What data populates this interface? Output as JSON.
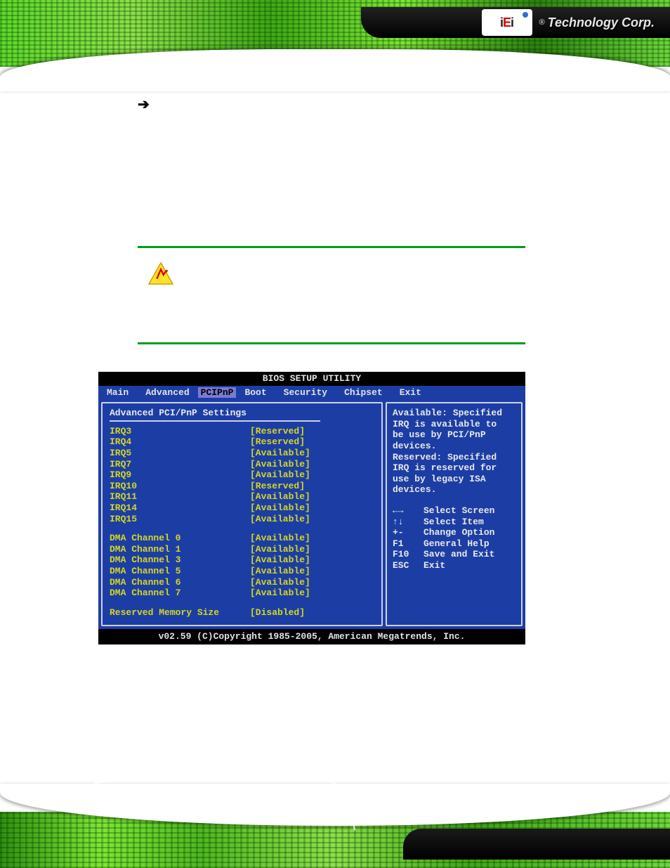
{
  "brand": {
    "logo_letters_i": "i",
    "logo_letters_e": "E",
    "logo_letters_i2": "i",
    "reg": "®",
    "name": "Technology Corp."
  },
  "arrow_glyph": "➔",
  "bios": {
    "title": "BIOS SETUP UTILITY",
    "tabs": [
      "Main",
      "Advanced",
      "PCIPnP",
      "Boot",
      "Security",
      "Chipset",
      "Exit"
    ],
    "active_tab_index": 2,
    "section_heading": "Advanced PCI/PnP Settings",
    "irq": [
      {
        "label": "IRQ3",
        "value": "[Reserved]"
      },
      {
        "label": "IRQ4",
        "value": "[Reserved]"
      },
      {
        "label": "IRQ5",
        "value": "[Available]"
      },
      {
        "label": "IRQ7",
        "value": "[Available]"
      },
      {
        "label": "IRQ9",
        "value": "[Available]"
      },
      {
        "label": "IRQ10",
        "value": "[Reserved]"
      },
      {
        "label": "IRQ11",
        "value": "[Available]"
      },
      {
        "label": "IRQ14",
        "value": "[Available]"
      },
      {
        "label": "IRQ15",
        "value": "[Available]"
      }
    ],
    "dma": [
      {
        "label": "DMA Channel 0",
        "value": "[Available]"
      },
      {
        "label": "DMA Channel 1",
        "value": "[Available]"
      },
      {
        "label": "DMA Channel 3",
        "value": "[Available]"
      },
      {
        "label": "DMA Channel 5",
        "value": "[Available]"
      },
      {
        "label": "DMA Channel 6",
        "value": "[Available]"
      },
      {
        "label": "DMA Channel 7",
        "value": "[Available]"
      }
    ],
    "reserved_mem": {
      "label": "Reserved Memory Size",
      "value": "[Disabled]"
    },
    "help": {
      "line1": "Available: Specified",
      "line2": "IRQ is available to",
      "line3": "be use by PCI/PnP",
      "line4": "devices.",
      "line5": "Reserved: Specified",
      "line6": "IRQ is reserved for",
      "line7": "use by legacy ISA",
      "line8": "devices."
    },
    "nav": [
      {
        "key": "←→",
        "label": "Select Screen"
      },
      {
        "key": "↑↓",
        "label": "Select Item"
      },
      {
        "key": "+-",
        "label": "Change Option"
      },
      {
        "key": "F1",
        "label": "General Help"
      },
      {
        "key": "F10",
        "label": "Save and Exit"
      },
      {
        "key": "ESC",
        "label": "Exit"
      }
    ],
    "footer": "v02.59 (C)Copyright 1985-2005, American Megatrends, Inc."
  }
}
